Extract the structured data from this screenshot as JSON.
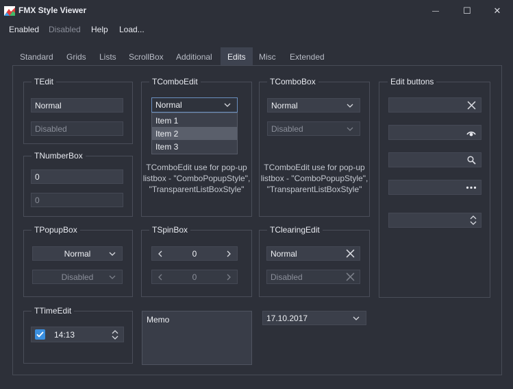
{
  "window": {
    "title": "FMX Style Viewer",
    "minimize_glyph": "—",
    "maximize_glyph": "☐",
    "close_glyph": "✕"
  },
  "menu": {
    "enabled": "Enabled",
    "disabled": "Disabled",
    "help": "Help",
    "load": "Load..."
  },
  "tabs": [
    "Standard",
    "Grids",
    "Lists",
    "ScrollBox",
    "Additional",
    "Edits",
    "Misc",
    "Extended"
  ],
  "active_tab": "Edits",
  "tedit": {
    "label": "TEdit",
    "normal": "Normal",
    "disabled": "Disabled"
  },
  "tcomboedit": {
    "label": "TComboEdit",
    "value": "Normal",
    "items": [
      "Item 1",
      "Item 2",
      "Item 3"
    ],
    "selected_item": "Item 2",
    "note": "TComboEdit use for pop-up listbox - \"ComboPopupStyle\", \"TransparentListBoxStyle\""
  },
  "tcombobox": {
    "label": "TComboBox",
    "normal": "Normal",
    "disabled": "Disabled",
    "note": "TComboEdit use for pop-up listbox - \"ComboPopupStyle\", \"TransparentListBoxStyle\""
  },
  "editbuttons": {
    "label": "Edit buttons"
  },
  "tnumberbox": {
    "label": "TNumberBox",
    "normal": "0",
    "disabled": "0"
  },
  "tpopupbox": {
    "label": "TPopupBox",
    "normal": "Normal",
    "disabled": "Disabled"
  },
  "tspinbox": {
    "label": "TSpinBox",
    "normal": "0",
    "disabled": "0"
  },
  "tclearingedit": {
    "label": "TClearingEdit",
    "normal": "Normal",
    "disabled": "Disabled"
  },
  "ttimeedit": {
    "label": "TTimeEdit",
    "value": "14:13",
    "checked": true
  },
  "memo": {
    "text": "Memo"
  },
  "dateedit": {
    "value": "17.10.2017"
  },
  "colors": {
    "background": "#2d3039",
    "accent": "#3a8fe0",
    "field": "#3b3f4a"
  }
}
